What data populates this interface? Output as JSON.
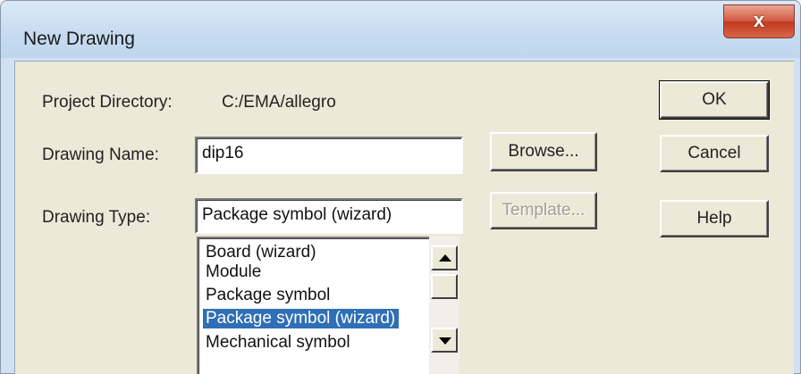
{
  "window": {
    "title": "New Drawing",
    "close_glyph": "x"
  },
  "project": {
    "label": "Project Directory:",
    "value": "C:/EMA/allegro"
  },
  "drawing_name": {
    "label": "Drawing Name:",
    "value": "dip16"
  },
  "drawing_type": {
    "label": "Drawing Type:",
    "value": "Package symbol (wizard)",
    "options": [
      "Board (wizard)",
      "Module",
      "Package symbol",
      "Package symbol (wizard)",
      "Mechanical symbol"
    ],
    "selected_index": 3
  },
  "buttons": {
    "browse": "Browse...",
    "template": "Template...",
    "ok": "OK",
    "cancel": "Cancel",
    "help": "Help"
  },
  "icons": {
    "close": "close-icon",
    "scroll_up": "scroll-up-arrow-icon",
    "scroll_down": "scroll-down-arrow-icon"
  }
}
